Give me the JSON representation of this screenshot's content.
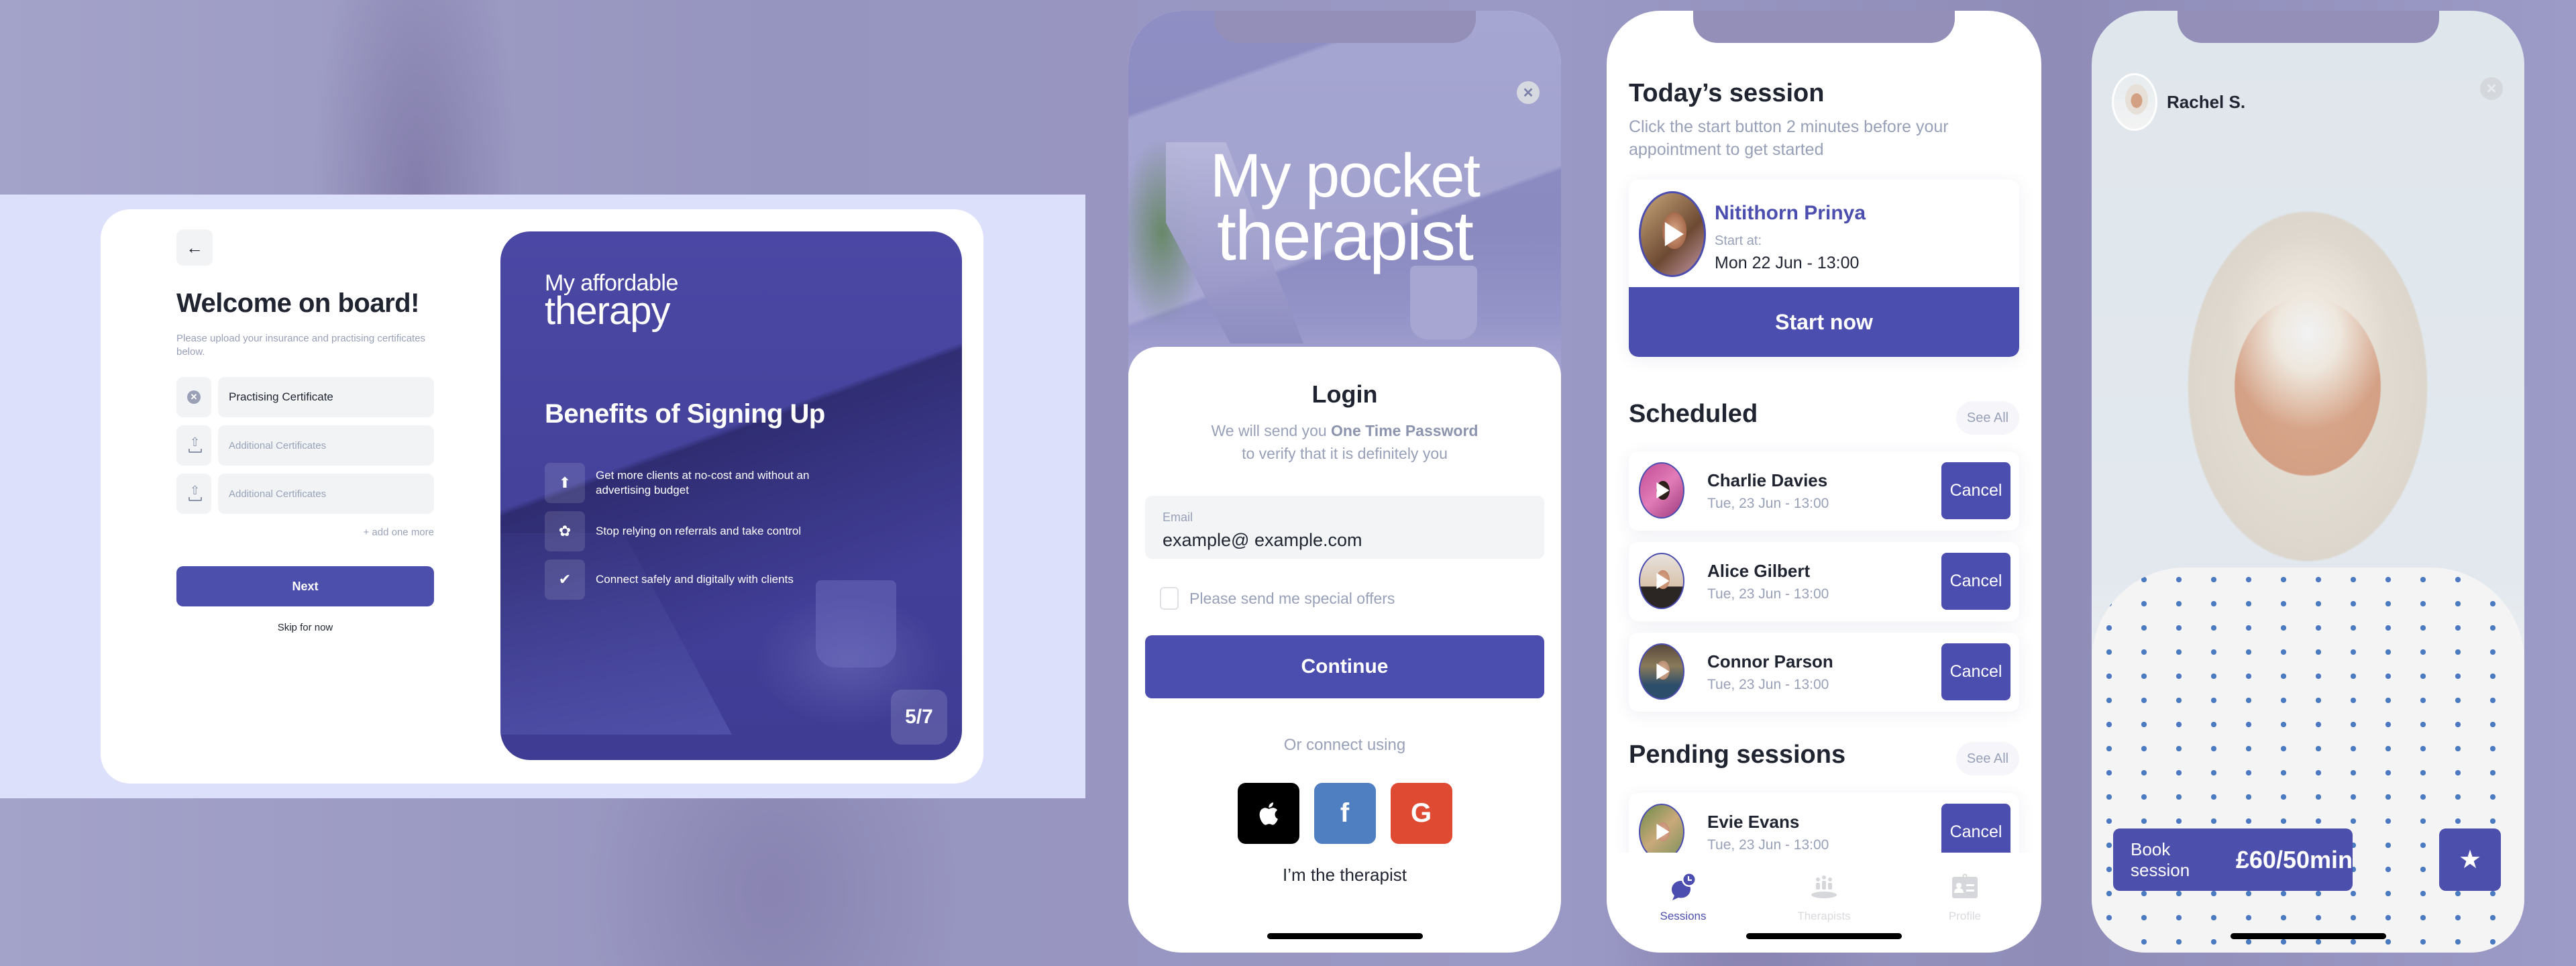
{
  "colors": {
    "brand_primary": "#4b4daf",
    "text_dark": "#1f2430",
    "text_muted": "#98a0b8",
    "field_bg": "#f2f3f5",
    "apple": "#000000",
    "facebook": "#4f7ec1",
    "google": "#df4a32"
  },
  "onboarding": {
    "back_icon": "arrow-left-icon",
    "back_glyph": "←",
    "title": "Welcome on board!",
    "subtitle": "Please upload your insurance and practising certificates below.",
    "certificates": [
      {
        "icon": "remove-circle-icon",
        "glyph": "✕",
        "value": "Practising Certificate",
        "placeholder": ""
      },
      {
        "icon": "upload-icon",
        "glyph": "",
        "value": "",
        "placeholder": "Additional Certificates"
      },
      {
        "icon": "upload-icon",
        "glyph": "",
        "value": "",
        "placeholder": "Additional Certificates"
      }
    ],
    "add_more": "+ add one more",
    "next_label": "Next",
    "skip_label": "Skip for now"
  },
  "benefits": {
    "brand_line1": "My affordable",
    "brand_line2": "therapy",
    "title": "Benefits of Signing Up",
    "items": [
      {
        "icon": "user-growth-icon",
        "glyph": "⬆",
        "text": "Get more clients at no-cost and without an advertising budget"
      },
      {
        "icon": "gear-control-icon",
        "glyph": "✿",
        "text": "Stop relying on referrals and take control"
      },
      {
        "icon": "shield-check-icon",
        "glyph": "✔",
        "text": "Connect safely and digitally with clients"
      }
    ],
    "pager": "5/7"
  },
  "login": {
    "brand_line1": "My pocket",
    "brand_line2": "therapist",
    "close_glyph": "✕",
    "title": "Login",
    "subtitle_pre": "We will send you ",
    "subtitle_bold": "One Time Password",
    "subtitle_post": "to verify that it is definitely you",
    "email_label": "Email",
    "email_value": "example@ example.com",
    "offers_label": "Please send me special offers",
    "offers_checked": false,
    "continue_label": "Continue",
    "connect_label": "Or connect using",
    "social": [
      {
        "name": "apple",
        "glyph": "",
        "color": "#000000"
      },
      {
        "name": "facebook",
        "glyph": "f",
        "color": "#4f7ec1"
      },
      {
        "name": "google",
        "glyph": "G",
        "color": "#df4a32"
      }
    ],
    "therapist_link": "I’m the therapist"
  },
  "sessions": {
    "today_title": "Today’s session",
    "today_subtitle": "Click the start button 2 minutes before your appointment to get started",
    "today": {
      "name": "Nitithorn Prinya",
      "start_label": "Start at:",
      "time": "Mon 22 Jun - 13:00",
      "start_button": "Start now"
    },
    "scheduled_title": "Scheduled",
    "see_all": "See All",
    "scheduled": [
      {
        "name": "Charlie Davies",
        "time": "Tue, 23 Jun - 13:00",
        "action": "Cancel"
      },
      {
        "name": "Alice Gilbert",
        "time": "Tue, 23 Jun - 13:00",
        "action": "Cancel"
      },
      {
        "name": "Connor Parson",
        "time": "Tue, 23 Jun - 13:00",
        "action": "Cancel"
      }
    ],
    "pending_title": "Pending sessions",
    "pending": [
      {
        "name": "Evie Evans",
        "time": "Tue, 23 Jun - 13:00",
        "action": "Cancel"
      }
    ],
    "tabs": [
      {
        "label": "Sessions",
        "icon": "chat-clock-icon",
        "active": true
      },
      {
        "label": "Therapists",
        "icon": "group-icon",
        "active": false
      },
      {
        "label": "Profile",
        "icon": "id-badge-icon",
        "active": false
      }
    ]
  },
  "profile": {
    "name": "Rachel S.",
    "close_glyph": "✕",
    "book_label": "Book session",
    "price": "£60/50min",
    "favorite_glyph": "★"
  }
}
